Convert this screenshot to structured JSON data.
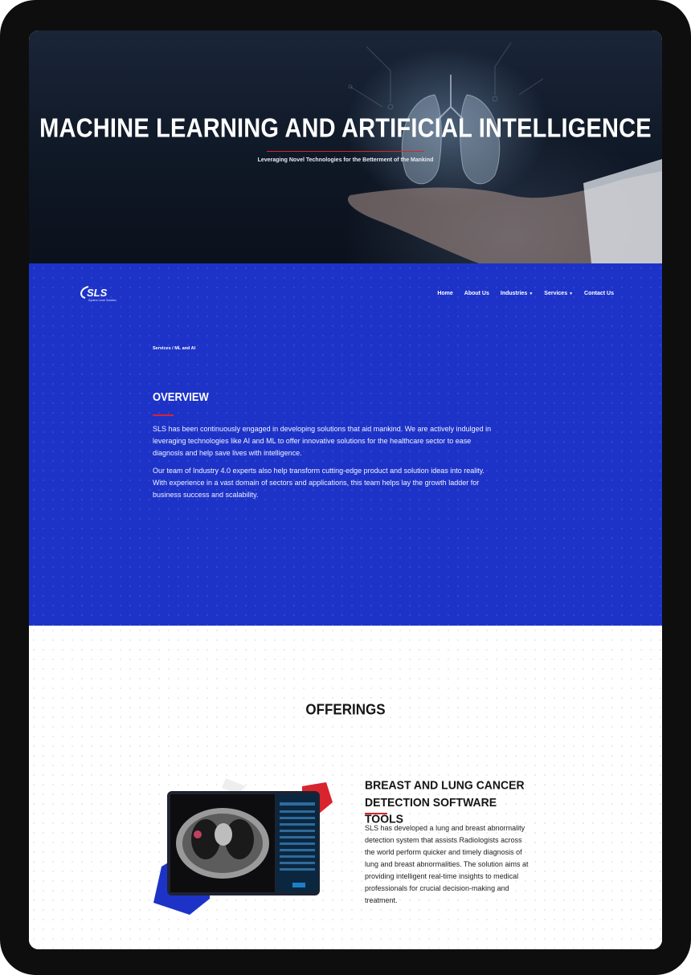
{
  "hero": {
    "title": "MACHINE LEARNING AND ARTIFICIAL INTELLIGENCE",
    "subtitle": "Leveraging Novel Technologies for the Betterment of the Mankind"
  },
  "header": {
    "logo_text": "SLS",
    "logo_tagline": "System Level Solution",
    "nav": [
      {
        "label": "Home"
      },
      {
        "label": "About Us"
      },
      {
        "label": "Industries"
      },
      {
        "label": "Services"
      },
      {
        "label": "Contact Us"
      }
    ]
  },
  "breadcrumb": {
    "text": "Services / ML and AI"
  },
  "overview": {
    "title": "OVERVIEW",
    "paragraphs": [
      "SLS has been continuously engaged in developing solutions that aid mankind. We are actively indulged in leveraging technologies like AI and ML to offer innovative solutions for the healthcare sector to ease diagnosis and help save lives with intelligence.",
      "Our team of Industry 4.0 experts also help transform cutting-edge product and solution ideas into reality. With experience in a vast domain of sectors and applications, this team helps lay the growth ladder for business success and scalability."
    ]
  },
  "offerings": {
    "title": "OFFERINGS",
    "items": [
      {
        "title": "BREAST AND LUNG CANCER DETECTION SOFTWARE TOOLS",
        "text": "SLS has developed a lung and breast abnormality detection system that assists Radiologists across the world perform quicker and timely diagnosis of lung and breast abnormalities. The solution aims at providing intelligent real-time insights to medical professionals for crucial decision-making and treatment."
      }
    ]
  },
  "colors": {
    "brand_blue": "#1d33c8",
    "accent_red": "#d8242e",
    "hero_dark": "#0f1826"
  }
}
